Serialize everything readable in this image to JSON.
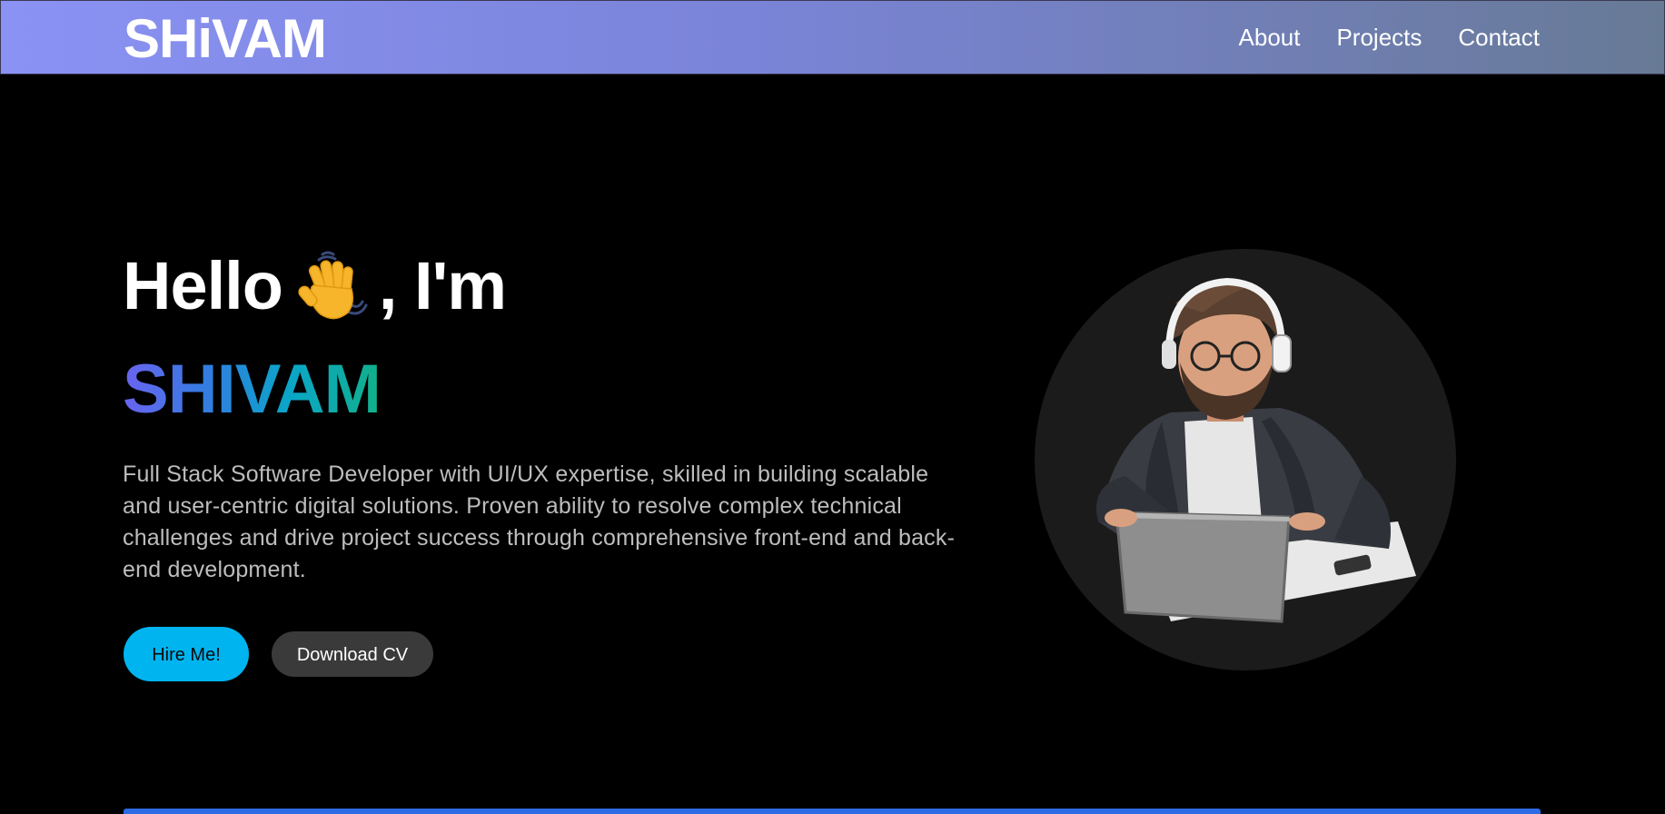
{
  "navbar": {
    "logo": "SHiVAM",
    "links": [
      "About",
      "Projects",
      "Contact"
    ]
  },
  "hero": {
    "greeting_prefix": "Hello",
    "greeting_suffix": ", I'm",
    "wave_icon": "waving-hand-icon",
    "name": "SHIVAM",
    "description": "Full Stack Software Developer with UI/UX expertise, skilled in building scalable and user-centric digital solutions. Proven ability to resolve complex technical challenges and drive project success through comprehensive front-end and back-end development.",
    "hire_button": "Hire Me!",
    "cv_button": "Download CV"
  },
  "colors": {
    "background": "#000000",
    "hire_button": "#00b4f0",
    "cv_button": "#3a3a3a",
    "accent_line": "#2d6be6",
    "name_gradient_start": "#6a63f0",
    "name_gradient_end": "#12b08a"
  }
}
